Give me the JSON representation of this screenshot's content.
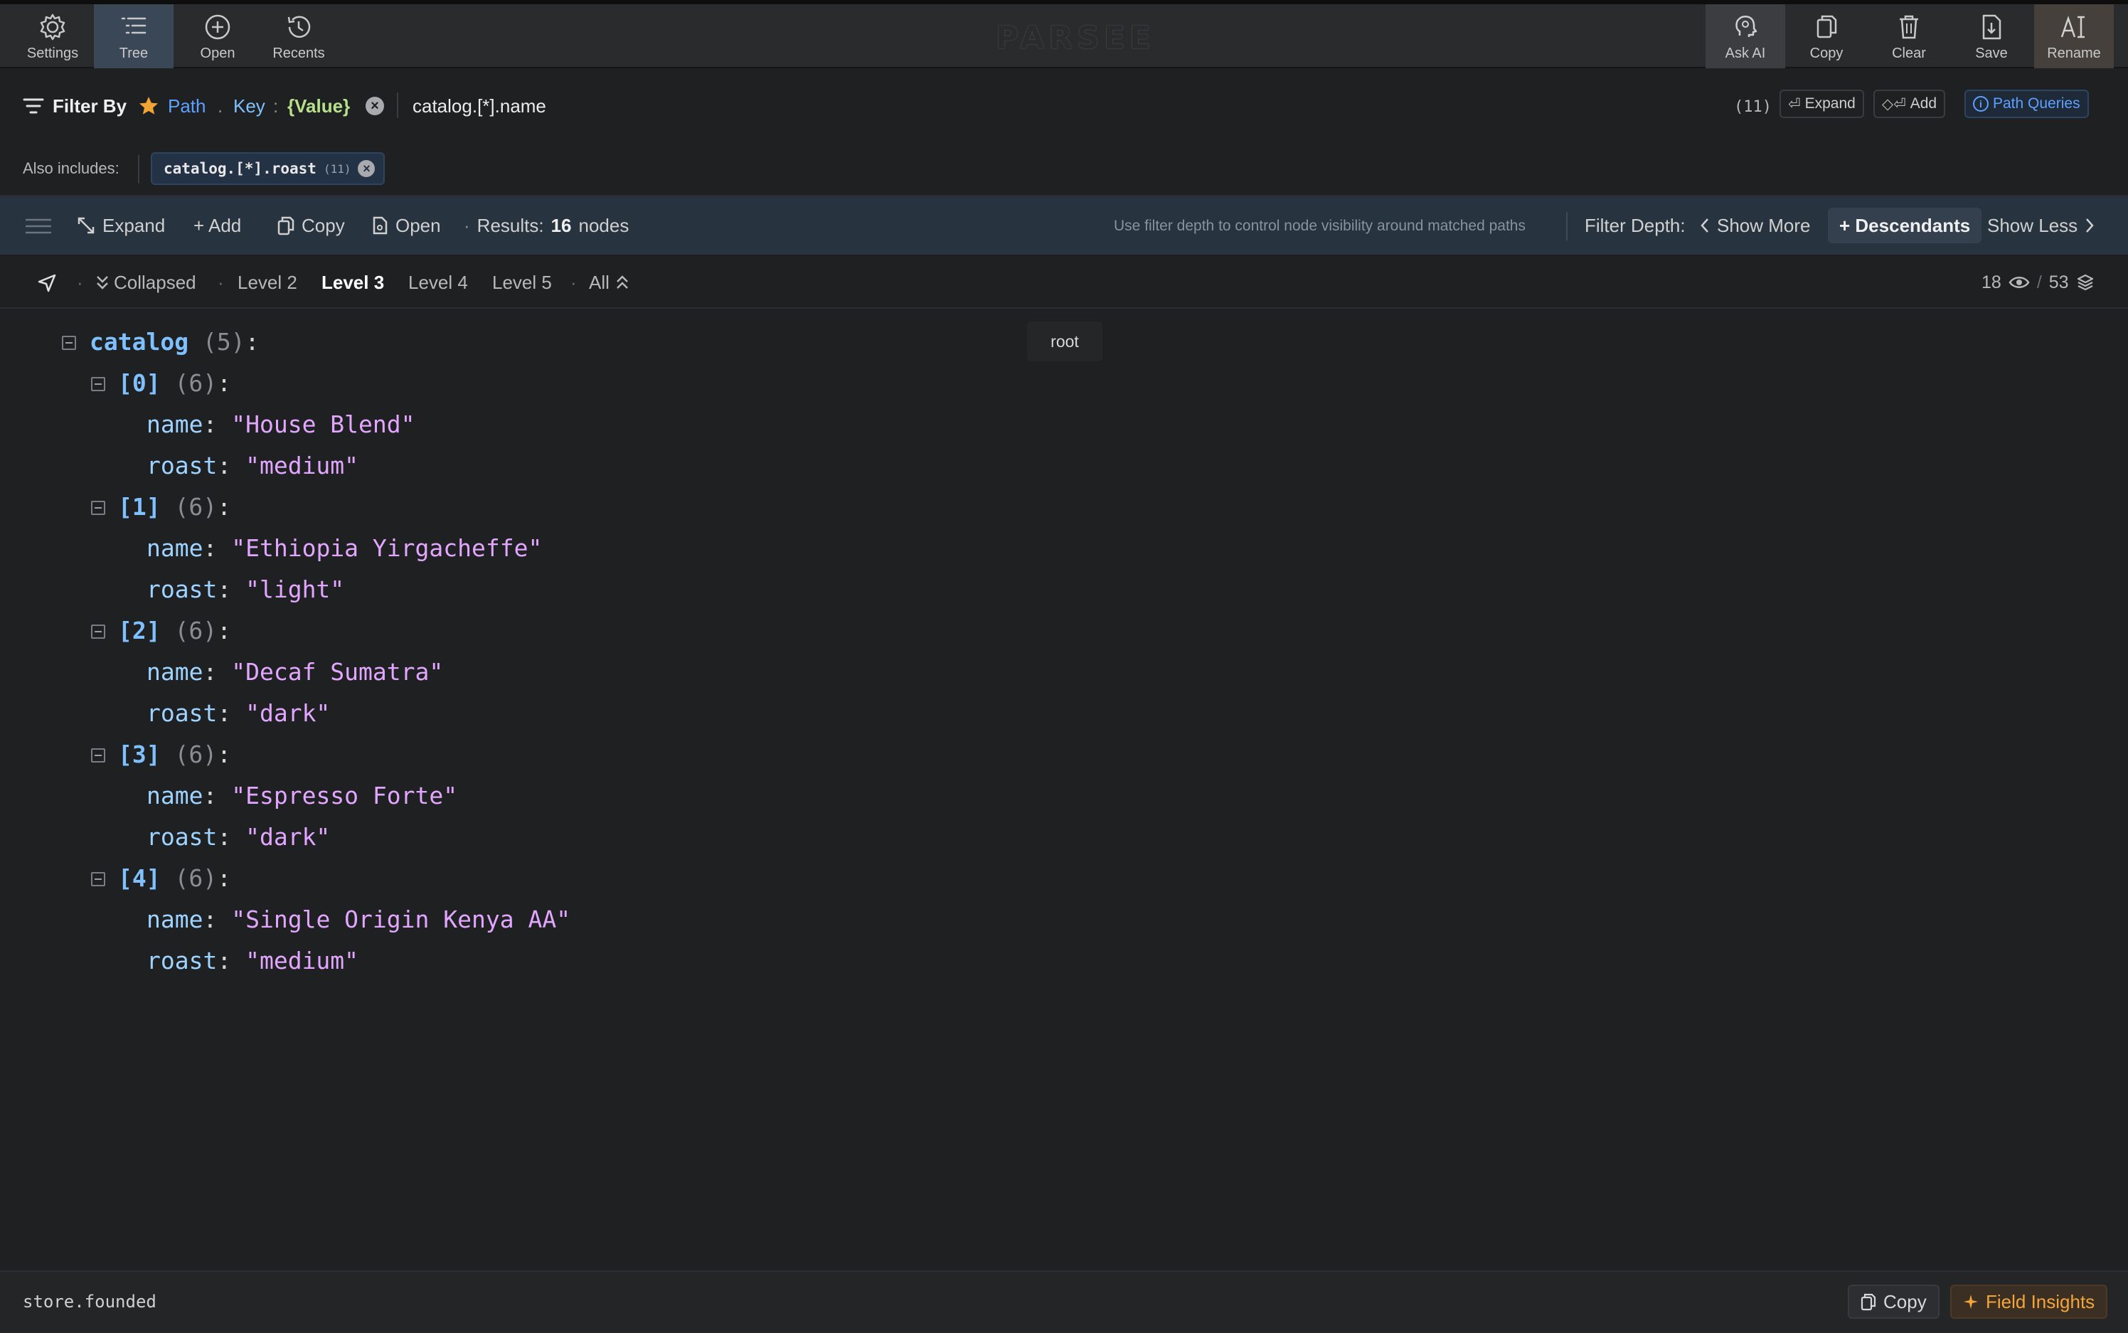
{
  "toolbar": {
    "left": [
      {
        "label": "Settings",
        "icon": "gear-icon"
      },
      {
        "label": "Tree",
        "icon": "tree-list-icon"
      },
      {
        "label": "Open",
        "icon": "plus-circle-icon"
      },
      {
        "label": "Recents",
        "icon": "history-icon"
      }
    ],
    "brand": "PARSEE",
    "right": [
      {
        "label": "Ask AI",
        "icon": "brain-icon"
      },
      {
        "label": "Copy",
        "icon": "copy-icon"
      },
      {
        "label": "Clear",
        "icon": "trash-icon"
      },
      {
        "label": "Save",
        "icon": "save-icon"
      },
      {
        "label": "Rename",
        "icon": "rename-icon"
      }
    ]
  },
  "filter": {
    "label": "Filter By",
    "path": "Path",
    "dot": ".",
    "key": "Key",
    "colon": ":",
    "value": "{Value}",
    "query": "catalog.[*].name",
    "count": "(11)",
    "expand": "Expand",
    "add": "Add",
    "path_queries": "Path Queries"
  },
  "also": {
    "label": "Also includes:",
    "chip_text": "catalog.[*].roast",
    "chip_count": "(11)"
  },
  "results": {
    "expand": "Expand",
    "add": "+ Add",
    "copy": "Copy",
    "open": "Open",
    "bullet": "·",
    "results_label": "Results:",
    "results_count": "16",
    "results_unit": "nodes",
    "hint": "Use filter depth to control node visibility around matched paths",
    "depth_label": "Filter Depth:",
    "show_more": "Show More",
    "descendants": "+ Descendants",
    "show_less": "Show Less"
  },
  "levels": {
    "collapsed": "Collapsed",
    "items": [
      "Level 2",
      "Level 3",
      "Level 4",
      "Level 5"
    ],
    "active": "Level 3",
    "all": "All",
    "visible": "18",
    "slash": "/",
    "total": "53"
  },
  "tree": {
    "root_key": "catalog",
    "root_count": "(5)",
    "tooltip": "root",
    "items": [
      {
        "index": "[0]",
        "count": "(6)",
        "name": "\"House Blend\"",
        "roast": "\"medium\""
      },
      {
        "index": "[1]",
        "count": "(6)",
        "name": "\"Ethiopia Yirgacheffe\"",
        "roast": "\"light\""
      },
      {
        "index": "[2]",
        "count": "(6)",
        "name": "\"Decaf Sumatra\"",
        "roast": "\"dark\""
      },
      {
        "index": "[3]",
        "count": "(6)",
        "name": "\"Espresso Forte\"",
        "roast": "\"dark\""
      },
      {
        "index": "[4]",
        "count": "(6)",
        "name": "\"Single Origin Kenya AA\"",
        "roast": "\"medium\""
      }
    ],
    "name_key": "name",
    "roast_key": "roast",
    "colon": ":"
  },
  "footer": {
    "path": "store.founded",
    "copy": "Copy",
    "insights": "Field Insights"
  }
}
